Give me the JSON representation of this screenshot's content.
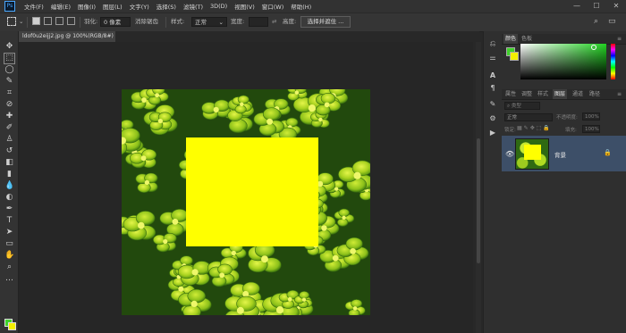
{
  "menubar": {
    "logo": "Ps",
    "items": [
      "文件(F)",
      "编辑(E)",
      "图像(I)",
      "图层(L)",
      "文字(Y)",
      "选择(S)",
      "滤镜(T)",
      "3D(D)",
      "视图(V)",
      "窗口(W)",
      "帮助(H)"
    ],
    "minimize": "—",
    "maximize": "☐",
    "close": "✕"
  },
  "options_bar": {
    "feather_label": "羽化:",
    "feather_value": "0 像素",
    "antialias_label": "消除锯齿",
    "style_label": "样式:",
    "style_value": "正常",
    "width_label": "宽度:",
    "height_label": "高度:",
    "select_subject_button": "选择并遮住 ..."
  },
  "document": {
    "tab_title": "ldof0u2eijj2.jpg @ 100%(RGB/8#) *",
    "tab_close": "×"
  },
  "panels": {
    "color_tabs": [
      "颜色",
      "色板"
    ],
    "layer_tabs": [
      "属性",
      "调整",
      "样式",
      "图层",
      "通道",
      "路径"
    ],
    "layer_kind_label": "类型",
    "blend_mode": "正常",
    "opacity_label": "不透明度:",
    "opacity_value": "100%",
    "lock_label": "锁定:",
    "fill_label": "填充:",
    "fill_value": "100%",
    "layer_name": "背景"
  },
  "colors": {
    "foreground": "#3fd12a",
    "background": "#f3ef00",
    "selection_fill": "#ffff00"
  }
}
